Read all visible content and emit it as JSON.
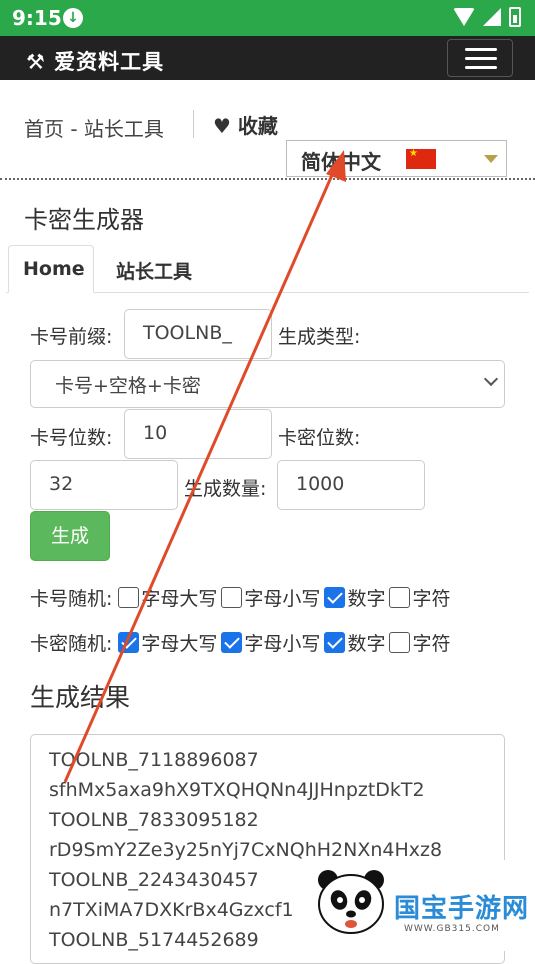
{
  "status": {
    "time": "9:15"
  },
  "navbar": {
    "brand": "爱资料工具"
  },
  "breadcrumb": {
    "text": "首页 - 站长工具"
  },
  "favorite": {
    "label": "收藏"
  },
  "language": {
    "selected": "简体中文"
  },
  "page": {
    "title": "卡密生成器"
  },
  "tabs": [
    {
      "label": "Home"
    },
    {
      "label": "站长工具"
    }
  ],
  "form": {
    "prefix_label": "卡号前缀:",
    "prefix_value": "TOOLNB_",
    "type_label": "生成类型:",
    "type_selected": "卡号+空格+卡密",
    "card_digits_label": "卡号位数:",
    "card_digits_value": "10",
    "pin_digits_label": "卡密位数:",
    "pin_digits_value": "32",
    "count_label": "生成数量:",
    "count_value": "1000",
    "generate_button": "生成"
  },
  "random_card": {
    "label": "卡号随机:",
    "options": [
      {
        "label": "字母大写",
        "checked": false
      },
      {
        "label": "字母小写",
        "checked": false
      },
      {
        "label": "数字",
        "checked": true
      },
      {
        "label": "字符",
        "checked": false
      }
    ]
  },
  "random_pin": {
    "label": "卡密随机:",
    "options": [
      {
        "label": "字母大写",
        "checked": true
      },
      {
        "label": "字母小写",
        "checked": true
      },
      {
        "label": "数字",
        "checked": true
      },
      {
        "label": "字符",
        "checked": false
      }
    ]
  },
  "result": {
    "title": "生成结果",
    "lines": [
      "TOOLNB_7118896087",
      "sfhMx5axa9hX9TXQHQNn4JJHnpztDkT2",
      "TOOLNB_7833095182",
      "rD9SmY2Ze3y25nYj7CxNQhH2NXn4Hxz8",
      "TOOLNB_2243430457",
      "n7TXiMA7DXKrBx4Gzxcf1",
      "TOOLNB_5174452689"
    ]
  },
  "watermark": {
    "title": "国宝手游网",
    "url": "WWW.GB315.COM"
  }
}
